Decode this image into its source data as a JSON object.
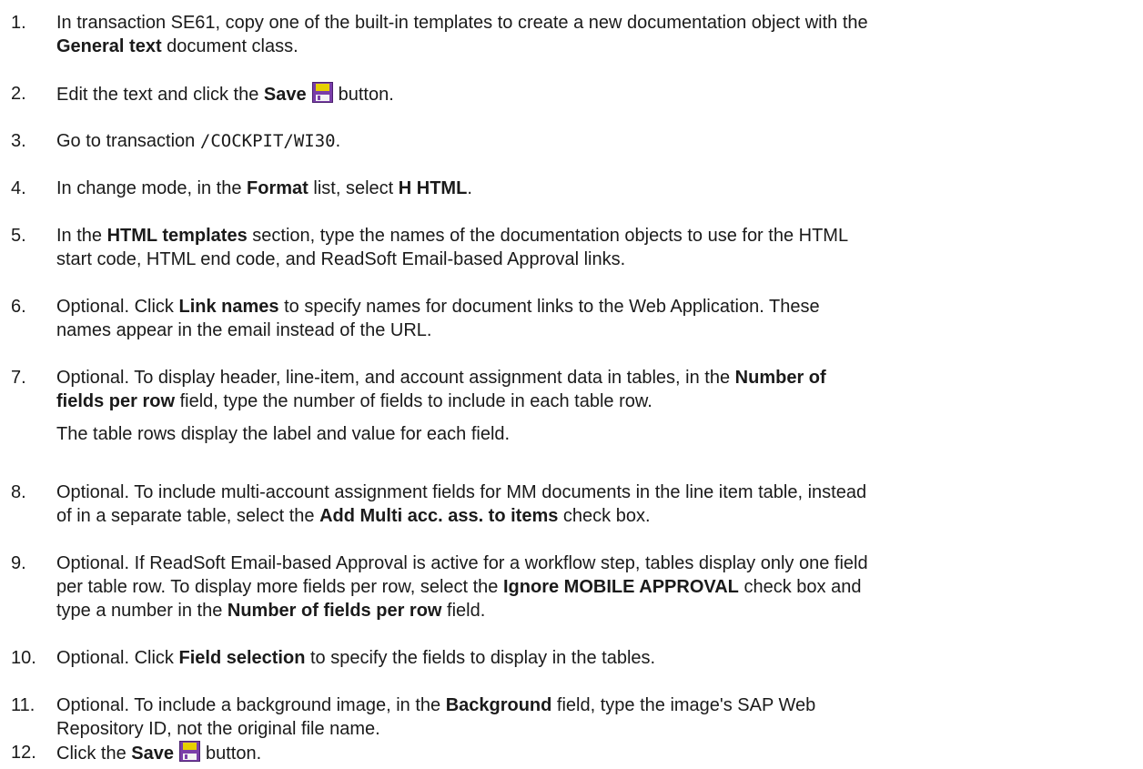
{
  "steps": [
    {
      "num": "1.",
      "lines": [
        [
          "In transaction SE61, copy one of the built-in templates to create a new documentation object with the"
        ],
        [
          "General text",
          " document class."
        ]
      ]
    },
    {
      "num": "2.",
      "parts": [
        "Edit the text and click the ",
        "Save",
        "button."
      ]
    },
    {
      "num": "3.",
      "parts": [
        "Go to transaction ",
        "/COCKPIT/WI30",
        "."
      ]
    },
    {
      "num": "4.",
      "parts": [
        "In change mode, in the ",
        "Format",
        " list, select ",
        "H HTML",
        "."
      ]
    },
    {
      "num": "5.",
      "lines": [
        [
          "In the ",
          "HTML templates",
          " section, type the names of the documentation objects to use for the HTML"
        ],
        [
          "start code, HTML end code, and ReadSoft Email-based Approval links."
        ]
      ]
    },
    {
      "num": "6.",
      "lines": [
        [
          "Optional. Click ",
          "Link names",
          " to specify names for document links to the Web Application. These"
        ],
        [
          "names appear in the email instead of the URL."
        ]
      ]
    },
    {
      "num": "7.",
      "lines": [
        [
          "Optional. To display header, line-item, and account assignment data in tables, in the ",
          "Number of"
        ],
        [
          "fields per row",
          " field, type the number of fields to include in each table row."
        ]
      ],
      "note": "The table rows display the label and value for each field."
    },
    {
      "num": "8.",
      "lines": [
        [
          "Optional. To include multi-account assignment fields for MM documents in the line item table, instead"
        ],
        [
          "of in a separate table, select the ",
          "Add Multi acc. ass. to items",
          " check box."
        ]
      ]
    },
    {
      "num": "9.",
      "lines": [
        [
          "Optional. If ReadSoft Email-based Approval is active for a workflow step, tables display only one field"
        ],
        [
          "per table row. To display more fields per row, select the ",
          "Ignore MOBILE APPROVAL",
          " check box and"
        ],
        [
          "type a number in the ",
          "Number of fields per row",
          " field."
        ]
      ]
    },
    {
      "num": "10.",
      "parts": [
        "Optional. Click ",
        "Field selection",
        " to specify the fields to display in the tables."
      ]
    },
    {
      "num": "11.",
      "lines": [
        [
          "Optional. To include a background image, in the ",
          "Background",
          " field, type the image's SAP Web"
        ],
        [
          "Repository ID, not the original file name."
        ]
      ]
    },
    {
      "num": "12.",
      "parts": [
        "Click the ",
        "Save",
        "button."
      ]
    }
  ],
  "icons": {
    "save": "save-floppy-icon",
    "save_color": "#7a3ea8",
    "save_label_color": "#e6d000"
  }
}
